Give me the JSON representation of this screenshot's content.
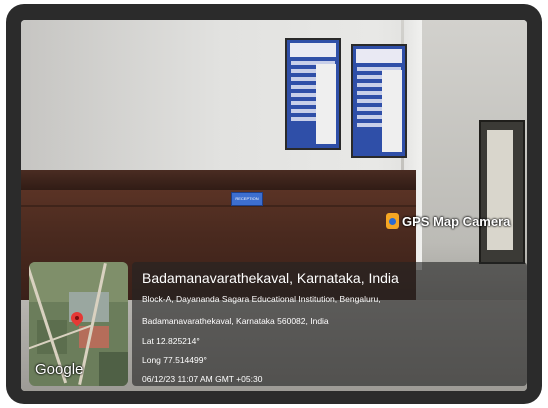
{
  "watermark": {
    "app_name": "GPS Map Camera",
    "icon": "map-pin-app-icon",
    "accent": "#f5a623"
  },
  "scene": {
    "sign_text": "RECEPTION"
  },
  "map": {
    "provider_logo": "Google",
    "pin_icon": "map-pin-icon",
    "pin_color": "#e53935"
  },
  "location": {
    "title": "Badamanavarathekaval, Karnataka, India",
    "address_line_1": "Block-A, Dayananda Sagara Educational Institution, Bengaluru,",
    "address_line_2": "Badamanavarathekaval, Karnataka 560082, India",
    "latitude": "Lat 12.825214°",
    "longitude": "Long 77.514499°",
    "timestamp": "06/12/23 11:07 AM GMT +05:30"
  }
}
